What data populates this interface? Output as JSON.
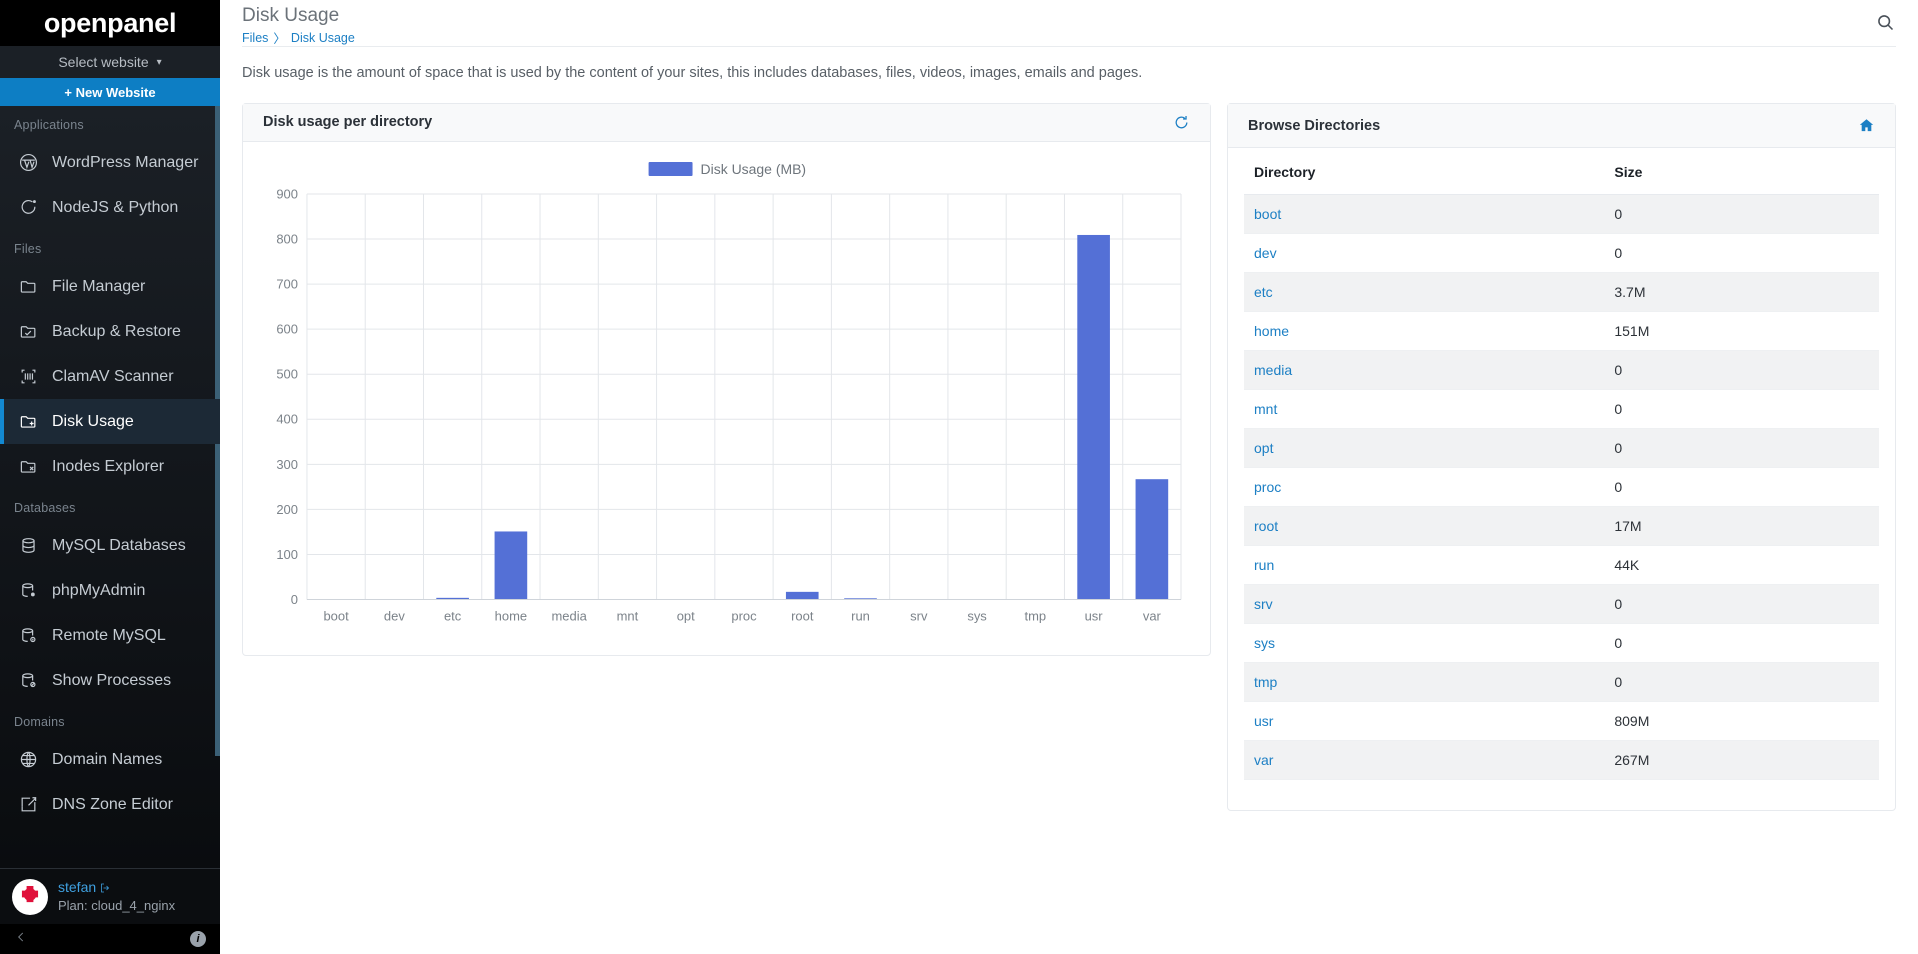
{
  "sidebar": {
    "brand": "openpanel",
    "select_website": "Select website",
    "new_website": "+ New Website",
    "sections": [
      {
        "label": "Applications",
        "items": [
          {
            "label": "WordPress Manager",
            "icon": "wordpress-icon",
            "active": false
          },
          {
            "label": "NodeJS & Python",
            "icon": "nodejs-icon",
            "active": false
          }
        ]
      },
      {
        "label": "Files",
        "items": [
          {
            "label": "File Manager",
            "icon": "folder-icon",
            "active": false
          },
          {
            "label": "Backup & Restore",
            "icon": "folder-check-icon",
            "active": false
          },
          {
            "label": "ClamAV Scanner",
            "icon": "scan-icon",
            "active": false
          },
          {
            "label": "Disk Usage",
            "icon": "folder-plus-icon",
            "active": true
          },
          {
            "label": "Inodes Explorer",
            "icon": "folder-x-icon",
            "active": false
          }
        ]
      },
      {
        "label": "Databases",
        "items": [
          {
            "label": "MySQL Databases",
            "icon": "database-icon",
            "active": false
          },
          {
            "label": "phpMyAdmin",
            "icon": "database-gear-icon",
            "active": false
          },
          {
            "label": "Remote MySQL",
            "icon": "database-info-icon",
            "active": false
          },
          {
            "label": "Show Processes",
            "icon": "database-block-icon",
            "active": false
          }
        ]
      },
      {
        "label": "Domains",
        "items": [
          {
            "label": "Domain Names",
            "icon": "globe-icon",
            "active": false
          },
          {
            "label": "DNS Zone Editor",
            "icon": "edit-square-icon",
            "active": false
          }
        ]
      }
    ],
    "user": {
      "name": "stefan",
      "plan": "Plan: cloud_4_nginx",
      "logout_icon": "logout-icon",
      "avatar_icon": "user-avatar"
    },
    "footer": {
      "collapse_icon": "chevron-left-icon",
      "info_icon": "info-icon"
    }
  },
  "header": {
    "title": "Disk Usage",
    "breadcrumb": [
      "Files",
      "Disk Usage"
    ],
    "breadcrumb_separator": "〉",
    "search_icon": "search-icon"
  },
  "intro": "Disk usage is the amount of space that is used by the content of your sites, this includes databases, files, videos, images, emails and pages.",
  "chart_card": {
    "title": "Disk usage per directory",
    "refresh_icon": "refresh-icon"
  },
  "directories_card": {
    "title": "Browse Directories",
    "home_icon": "home-icon",
    "columns": [
      "Directory",
      "Size"
    ],
    "rows": [
      {
        "directory": "boot",
        "size": "0"
      },
      {
        "directory": "dev",
        "size": "0"
      },
      {
        "directory": "etc",
        "size": "3.7M"
      },
      {
        "directory": "home",
        "size": "151M"
      },
      {
        "directory": "media",
        "size": "0"
      },
      {
        "directory": "mnt",
        "size": "0"
      },
      {
        "directory": "opt",
        "size": "0"
      },
      {
        "directory": "proc",
        "size": "0"
      },
      {
        "directory": "root",
        "size": "17M"
      },
      {
        "directory": "run",
        "size": "44K"
      },
      {
        "directory": "srv",
        "size": "0"
      },
      {
        "directory": "sys",
        "size": "0"
      },
      {
        "directory": "tmp",
        "size": "0"
      },
      {
        "directory": "usr",
        "size": "809M"
      },
      {
        "directory": "var",
        "size": "267M"
      }
    ]
  },
  "colors": {
    "accent_blue": "#1389d2",
    "link_blue": "#1c7fc4",
    "bar_blue": "#5470d6",
    "sidebar_bg": "#13171c",
    "sidebar_active": "#1c2936"
  },
  "chart_data": {
    "type": "bar",
    "title": "Disk usage per directory",
    "xlabel": "",
    "ylabel": "",
    "ylim": [
      0,
      900
    ],
    "yticks": [
      0,
      100,
      200,
      300,
      400,
      500,
      600,
      700,
      800,
      900
    ],
    "grid": true,
    "legend": {
      "position": "top-center",
      "entries": [
        "Disk Usage (MB)"
      ]
    },
    "series": [
      {
        "name": "Disk Usage (MB)",
        "color": "#5470d6",
        "values": [
          0,
          0,
          3.7,
          151,
          0,
          0,
          0,
          0,
          17,
          0.044,
          0,
          0,
          0,
          809,
          267
        ]
      }
    ],
    "categories": [
      "boot",
      "dev",
      "etc",
      "home",
      "media",
      "mnt",
      "opt",
      "proc",
      "root",
      "run",
      "srv",
      "sys",
      "tmp",
      "usr",
      "var"
    ]
  }
}
